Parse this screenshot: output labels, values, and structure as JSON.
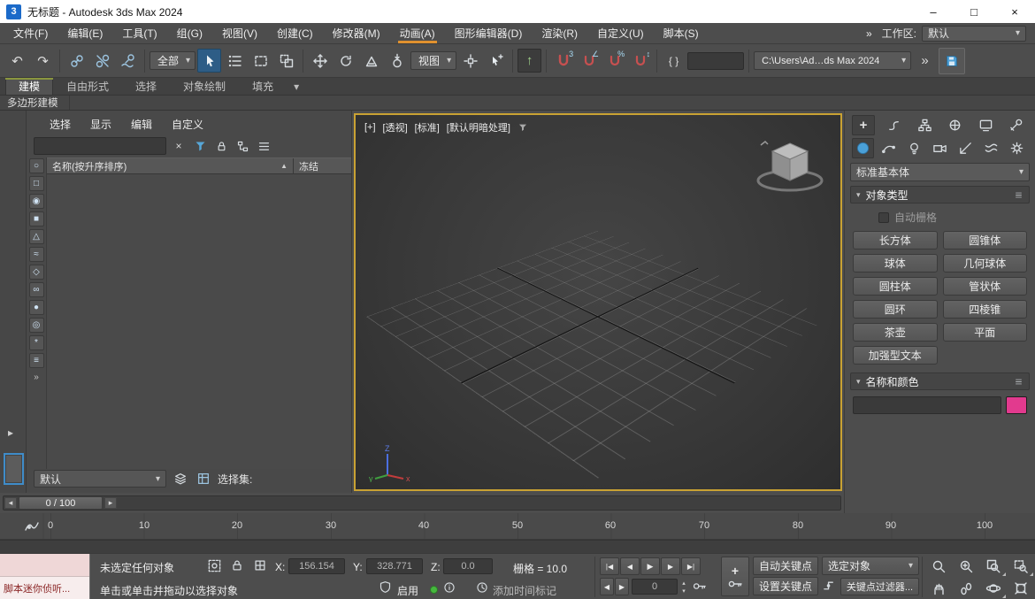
{
  "glyphs": {
    "minimize": "–",
    "maximize": "□",
    "close": "×",
    "dropdown": "▾",
    "overflow": "»",
    "undo": "↶",
    "redo": "↷",
    "left_arrow": "◂",
    "right_arrow": "▸",
    "sort_asc": "▲",
    "up": "▴",
    "down": "▾",
    "kbd_override": "↑",
    "named_sets": "{ }",
    "clear": "×",
    "plus": "+"
  },
  "titlebar": {
    "badge": "3",
    "title": "无标题 - Autodesk 3ds Max 2024"
  },
  "menubar": {
    "items": [
      "文件(F)",
      "编辑(E)",
      "工具(T)",
      "组(G)",
      "视图(V)",
      "创建(C)",
      "修改器(M)",
      "动画(A)",
      "图形编辑器(D)",
      "渲染(R)",
      "自定义(U)",
      "脚本(S)"
    ],
    "workspace_label": "工作区:",
    "workspace_value": "默认"
  },
  "toolbar": {
    "selection_filter": "全部",
    "coord_system": "视图",
    "project_path": "C:\\Users\\Ad…ds Max 2024",
    "snap_3d": "3",
    "snap_angle": "∠",
    "snap_percent": "%",
    "snap_spinner": "↕"
  },
  "ribbon": {
    "tabs": [
      "建模",
      "自由形式",
      "选择",
      "对象绘制",
      "填充"
    ],
    "panel_label": "多边形建模"
  },
  "scene_explorer": {
    "menu": [
      "选择",
      "显示",
      "编辑",
      "自定义"
    ],
    "name_column": "名称(按升序排序)",
    "freeze_column": "冻结",
    "display_filters": [
      {
        "name": "display-geometry",
        "glyph": "○"
      },
      {
        "name": "display-shapes",
        "glyph": "□"
      },
      {
        "name": "display-lights",
        "glyph": "◉"
      },
      {
        "name": "display-cameras",
        "glyph": "■"
      },
      {
        "name": "display-helpers",
        "glyph": "△"
      },
      {
        "name": "display-space-warps",
        "glyph": "≈"
      },
      {
        "name": "display-groups",
        "glyph": "◇"
      },
      {
        "name": "display-xrefs",
        "glyph": "∞"
      },
      {
        "name": "display-materials",
        "glyph": "●"
      },
      {
        "name": "display-bones",
        "glyph": "◎"
      },
      {
        "name": "display-frozen",
        "glyph": "*"
      },
      {
        "name": "display-list",
        "glyph": "≡"
      }
    ],
    "overflow": "»",
    "layer_preset": "默认",
    "selection_set_label": "选择集:"
  },
  "viewport": {
    "labels": [
      "[+]",
      "[透视]",
      "[标准]",
      "[默认明暗处理]"
    ],
    "axis_x": "x",
    "axis_y": "y",
    "axis_z": "Z"
  },
  "command_panel": {
    "category": "标准基本体",
    "object_type_title": "对象类型",
    "autogrid_label": "自动栅格",
    "object_buttons": [
      "长方体",
      "圆锥体",
      "球体",
      "几何球体",
      "圆柱体",
      "管状体",
      "圆环",
      "四棱锥",
      "茶壶",
      "平面",
      "加强型文本"
    ],
    "name_color_title": "名称和颜色",
    "swatch_color": "#e23a8e",
    "swatch_style": "background:#e23a8e"
  },
  "timeline": {
    "slider_label": "0 / 100",
    "ticks": [
      "0",
      "10",
      "20",
      "30",
      "40",
      "50",
      "60",
      "70",
      "80",
      "90",
      "100"
    ]
  },
  "statusbar": {
    "listener_label": "脚本迷你侦听...",
    "status_text": "未选定任何对象",
    "prompt_text": "单击或单击并拖动以选择对象",
    "x_label": "X:",
    "x_value": "156.154",
    "y_label": "Y:",
    "y_value": "328.771",
    "z_label": "Z:",
    "z_value": "0.0",
    "grid_text": "栅格 = 10.0",
    "security_label": "启用",
    "time_tag_text": "添加时间标记",
    "playback": [
      {
        "name": "go-to-start",
        "glyph": "|◀"
      },
      {
        "name": "previous-frame",
        "glyph": "◀"
      },
      {
        "name": "play",
        "glyph": "▶"
      },
      {
        "name": "next-frame",
        "glyph": "▶"
      },
      {
        "name": "go-to-end",
        "glyph": "▶|"
      }
    ],
    "frame_value": "0",
    "auto_key_label": "自动关键点",
    "set_key_label": "设置关键点",
    "key_filter_target": "选定对象",
    "key_filters_label": "关键点过滤器..."
  }
}
